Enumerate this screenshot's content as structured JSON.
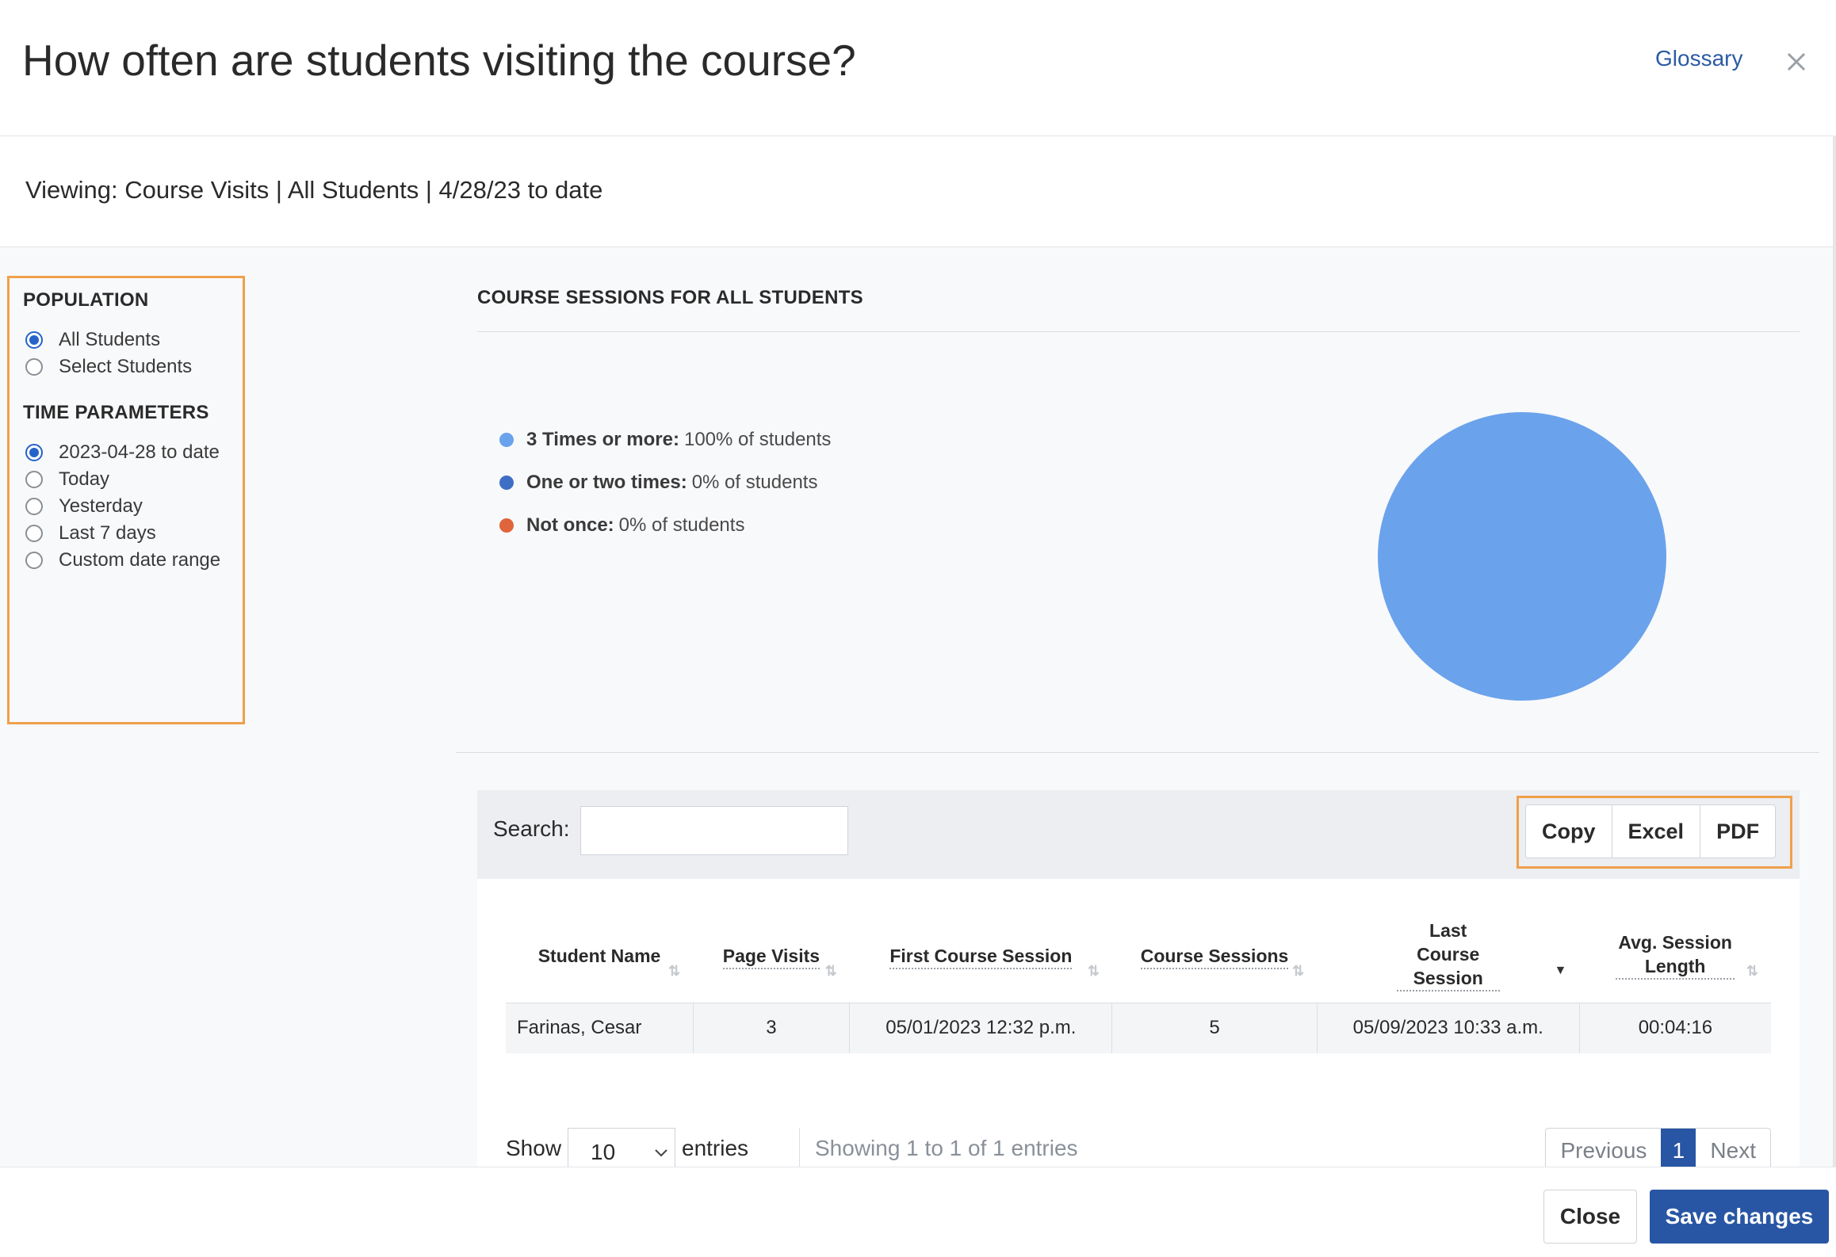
{
  "header": {
    "title": "How often are students visiting the course?",
    "glossary_label": "Glossary",
    "close_icon": "close-icon"
  },
  "subheader": {
    "viewing": "Viewing: Course Visits | All Students | 4/28/23 to date"
  },
  "filters": {
    "population": {
      "heading": "POPULATION",
      "options": [
        {
          "label": "All Students",
          "checked": true
        },
        {
          "label": "Select Students",
          "checked": false
        }
      ]
    },
    "time": {
      "heading": "TIME PARAMETERS",
      "options": [
        {
          "label": "2023-04-28 to date",
          "checked": true
        },
        {
          "label": "Today",
          "checked": false
        },
        {
          "label": "Yesterday",
          "checked": false
        },
        {
          "label": "Last 7 days",
          "checked": false
        },
        {
          "label": "Custom date range",
          "checked": false
        }
      ]
    }
  },
  "chart_data": {
    "type": "pie",
    "title": "COURSE SESSIONS FOR ALL STUDENTS",
    "categories": [
      "3 Times or more:",
      "One or two times:",
      "Not once:"
    ],
    "values": [
      100,
      0,
      0
    ],
    "value_labels": [
      "100% of students",
      "0% of students",
      "0% of students"
    ],
    "colors": [
      "#6aa2ec",
      "#3f6fc4",
      "#e0643c"
    ],
    "legend_position": "left"
  },
  "table": {
    "search_label": "Search:",
    "search_value": "",
    "export_buttons": [
      "Copy",
      "Excel",
      "PDF"
    ],
    "columns": [
      {
        "label": "Student Name",
        "sort": "unsorted"
      },
      {
        "label": "Page Visits",
        "sort": "unsorted"
      },
      {
        "label": "First Course Session",
        "sort": "unsorted"
      },
      {
        "label": "Course Sessions",
        "sort": "unsorted"
      },
      {
        "label": "Last Course Session",
        "sort": "descending"
      },
      {
        "label": "Avg. Session Length",
        "sort": "unsorted"
      }
    ],
    "rows": [
      [
        "Farinas, Cesar",
        "3",
        "05/01/2023 12:32 p.m.",
        "5",
        "05/09/2023 10:33 a.m.",
        "00:04:16"
      ]
    ],
    "show_label": "Show",
    "entries_value": "10",
    "entries_label": "entries",
    "info": "Showing 1 to 1 of 1 entries",
    "pager": {
      "previous": "Previous",
      "current": "1",
      "next": "Next"
    }
  },
  "footer": {
    "close_label": "Close",
    "save_label": "Save changes"
  }
}
